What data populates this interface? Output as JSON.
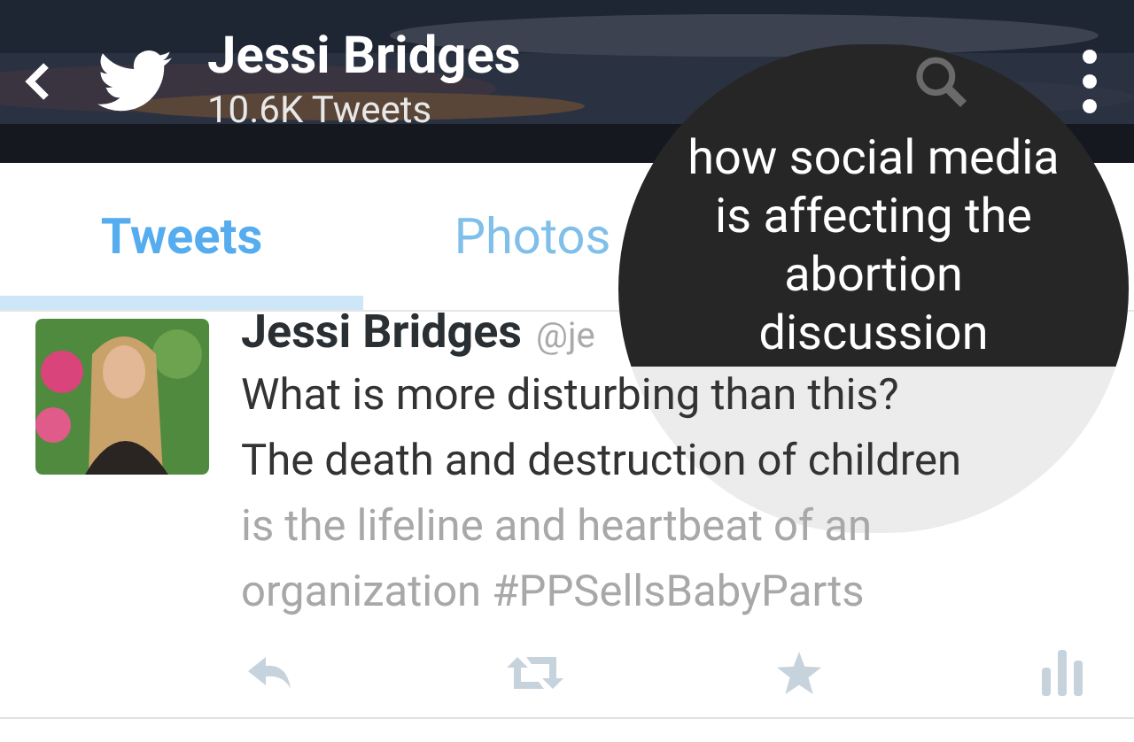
{
  "header": {
    "name": "Jessi Bridges",
    "tweet_count": "10.6K Tweets"
  },
  "tabs": [
    {
      "label": "Tweets",
      "selected": true
    },
    {
      "label": "Photos",
      "selected": false
    }
  ],
  "tweet": {
    "author": "Jessi Bridges",
    "handle": "@je",
    "lines": [
      {
        "text": "What is more disturbing than this?",
        "faded": false
      },
      {
        "text": "The death and destruction of children",
        "faded": false
      },
      {
        "text": "is the lifeline and heartbeat of an",
        "faded": true
      },
      {
        "text": "organization #PPSellsBabyParts",
        "faded": true
      }
    ]
  },
  "overlay": {
    "caption_lines": [
      "how social media",
      "is affecting the",
      "abortion",
      "discussion"
    ]
  }
}
